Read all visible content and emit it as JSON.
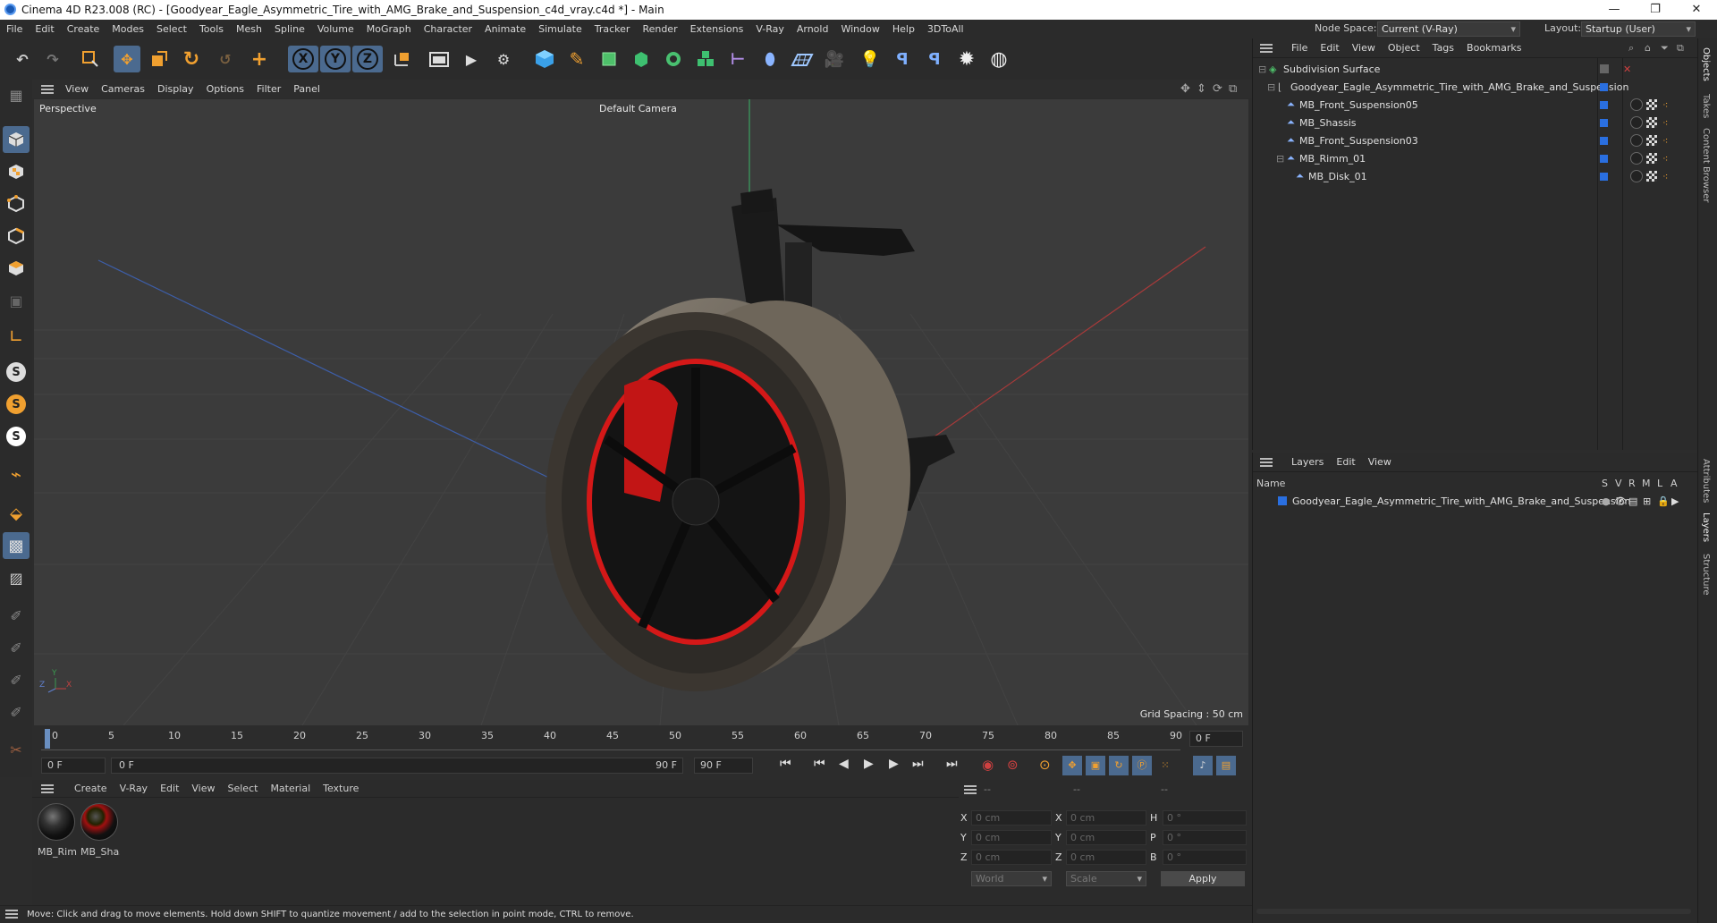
{
  "window": {
    "title": "Cinema 4D R23.008 (RC) - [Goodyear_Eagle_Asymmetric_Tire_with_AMG_Brake_and_Suspension_c4d_vray.c4d *] - Main",
    "min": "—",
    "max": "❐",
    "close": "✕"
  },
  "menubar": {
    "items": [
      "File",
      "Edit",
      "Create",
      "Modes",
      "Select",
      "Tools",
      "Mesh",
      "Spline",
      "Volume",
      "MoGraph",
      "Character",
      "Animate",
      "Simulate",
      "Tracker",
      "Render",
      "Extensions",
      "V-Ray",
      "Arnold",
      "Window",
      "Help",
      "3DToAll"
    ],
    "node_space_label": "Node Space:",
    "node_space_value": "Current (V-Ray)",
    "layout_label": "Layout:",
    "layout_value": "Startup (User)"
  },
  "toolbar": {
    "axis_x": "X",
    "axis_y": "Y",
    "axis_z": "Z"
  },
  "viewport": {
    "menu": [
      "View",
      "Cameras",
      "Display",
      "Options",
      "Filter",
      "Panel"
    ],
    "label": "Perspective",
    "camera": "Default Camera",
    "grid_spacing": "Grid Spacing : 50 cm",
    "axis_y": "Y",
    "axis_z": "Z",
    "axis_x": "X"
  },
  "timeline": {
    "ticks": [
      "0",
      "5",
      "10",
      "15",
      "20",
      "25",
      "30",
      "35",
      "40",
      "45",
      "50",
      "55",
      "60",
      "65",
      "70",
      "75",
      "80",
      "85",
      "90"
    ],
    "current_frame": "0 F"
  },
  "transport": {
    "start": "0 F",
    "range_start": "0 F",
    "range_end": "90 F",
    "end": "90 F"
  },
  "materials": {
    "menu": [
      "Create",
      "V-Ray",
      "Edit",
      "View",
      "Select",
      "Material",
      "Texture"
    ],
    "items": [
      {
        "name": "MB_Rimm"
      },
      {
        "name": "MB_Shas"
      }
    ]
  },
  "coordinates": {
    "header": [
      "--",
      "--",
      "--"
    ],
    "pos": [
      {
        "axis": "X",
        "value": "0 cm"
      },
      {
        "axis": "Y",
        "value": "0 cm"
      },
      {
        "axis": "Z",
        "value": "0 cm"
      }
    ],
    "size": [
      {
        "axis": "X",
        "value": "0 cm"
      },
      {
        "axis": "Y",
        "value": "0 cm"
      },
      {
        "axis": "Z",
        "value": "0 cm"
      }
    ],
    "rot": [
      {
        "axis": "H",
        "value": "0 °"
      },
      {
        "axis": "P",
        "value": "0 °"
      },
      {
        "axis": "B",
        "value": "0 °"
      }
    ],
    "mode": "World",
    "scale": "Scale",
    "apply": "Apply"
  },
  "status": "Move: Click and drag to move elements. Hold down SHIFT to quantize movement / add to the selection in point mode, CTRL to remove.",
  "objects": {
    "menu": [
      "File",
      "Edit",
      "View",
      "Object",
      "Tags",
      "Bookmarks"
    ],
    "rows": [
      {
        "name": "Subdivision Surface"
      },
      {
        "name": "Goodyear_Eagle_Asymmetric_Tire_with_AMG_Brake_and_Suspension"
      },
      {
        "name": "MB_Front_Suspension05"
      },
      {
        "name": "MB_Shassis"
      },
      {
        "name": "MB_Front_Suspension03"
      },
      {
        "name": "MB_Rimm_01"
      },
      {
        "name": "MB_Disk_01"
      }
    ]
  },
  "layers": {
    "menu": [
      "Layers",
      "Edit",
      "View"
    ],
    "col_name": "Name",
    "cols": [
      "S",
      "V",
      "R",
      "M",
      "L",
      "A"
    ],
    "rows": [
      {
        "name": "Goodyear_Eagle_Asymmetric_Tire_with_AMG_Brake_and_Suspension"
      }
    ]
  },
  "right_tabs": [
    "Objects",
    "Takes",
    "Content Browser",
    "Attributes",
    "Layers",
    "Structure"
  ]
}
